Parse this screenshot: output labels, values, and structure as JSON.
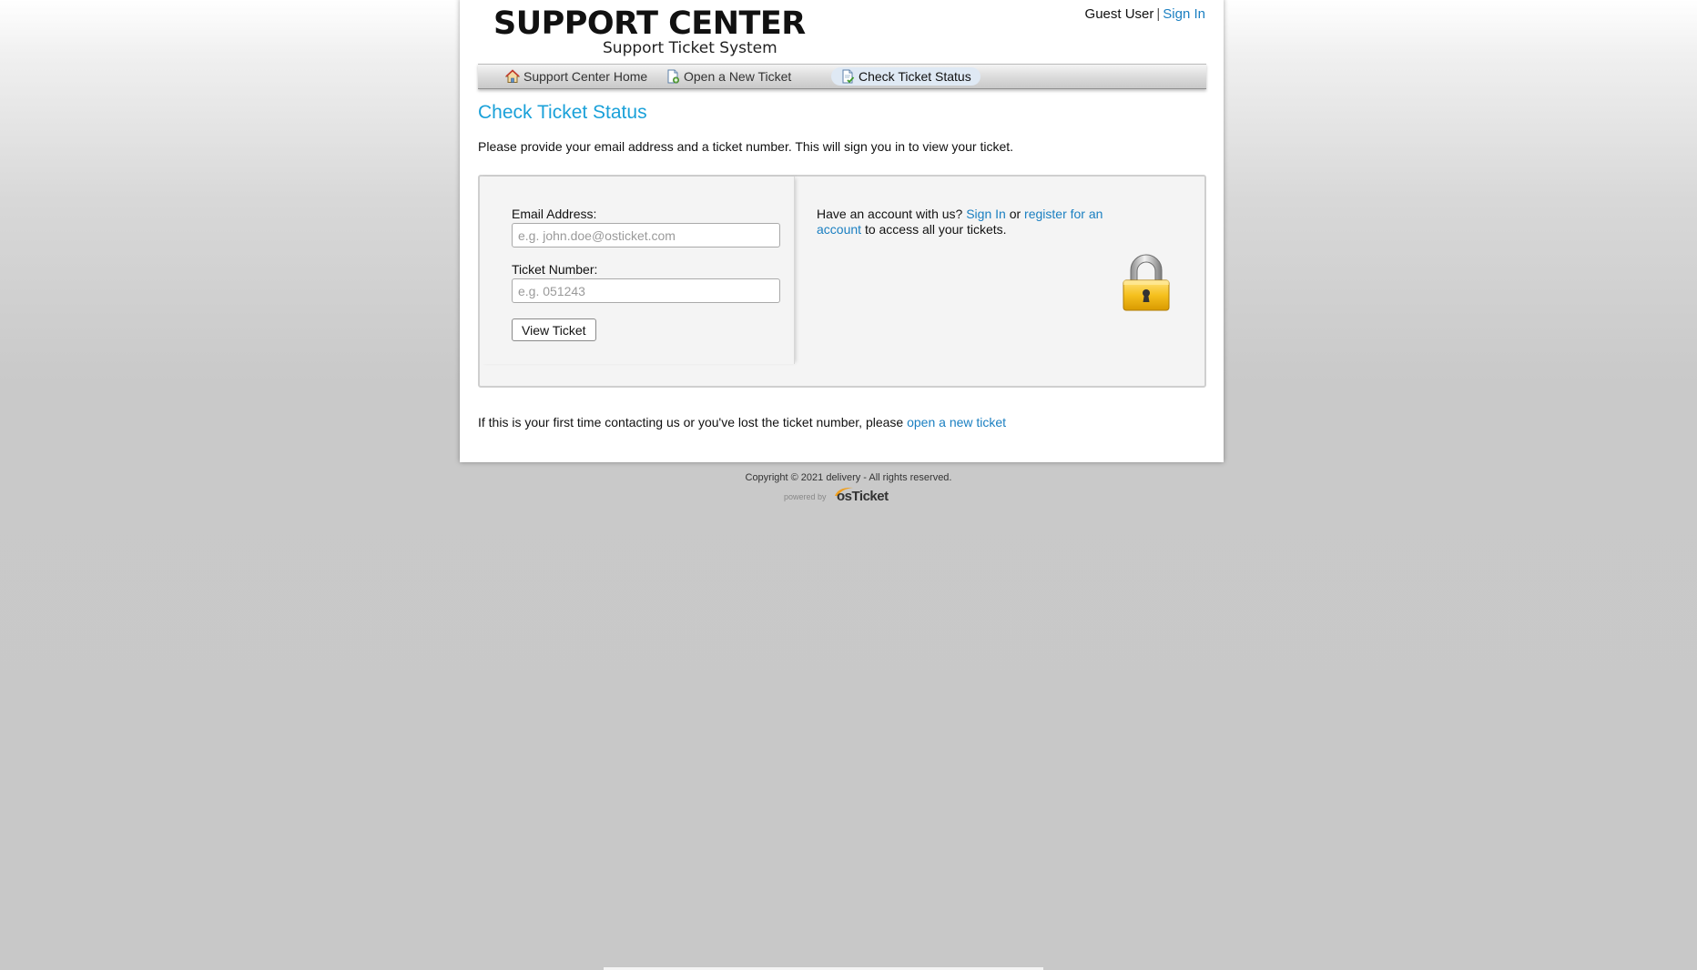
{
  "header": {
    "logo_title": "SUPPORT CENTER",
    "logo_subtitle": "Support Ticket System",
    "user_label": "Guest User",
    "separator": "|",
    "sign_in": "Sign In"
  },
  "nav": {
    "items": [
      {
        "label": "Support Center Home",
        "icon": "home-icon",
        "active": false
      },
      {
        "label": "Open a New Ticket",
        "icon": "new-ticket-icon",
        "active": false
      },
      {
        "label": "Check Ticket Status",
        "icon": "ticket-status-icon",
        "active": true
      }
    ]
  },
  "main": {
    "title": "Check Ticket Status",
    "intro": "Please provide your email address and a ticket number. This will sign you in to view your ticket.",
    "form": {
      "email_label": "Email Address:",
      "email_placeholder": "e.g. john.doe@osticket.com",
      "email_value": "",
      "ticket_label": "Ticket Number:",
      "ticket_placeholder": "e.g. 051243",
      "ticket_value": "",
      "submit_label": "View Ticket"
    },
    "account_info": {
      "prefix": "Have an account with us?",
      "sign_in": "Sign In",
      "or": "or",
      "register": "register for an account",
      "suffix": "to access all your tickets."
    },
    "bottom_note": {
      "text": "If this is your first time contacting us or you've lost the ticket number, please",
      "link": "open a new ticket"
    }
  },
  "footer": {
    "copyright": "Copyright © 2021 delivery - All rights reserved.",
    "powered_by": "powered by",
    "brand": "osTicket"
  },
  "colors": {
    "link": "#1a7fc1",
    "title": "#1aa1d9",
    "active_tab": "#dfe9f4"
  }
}
